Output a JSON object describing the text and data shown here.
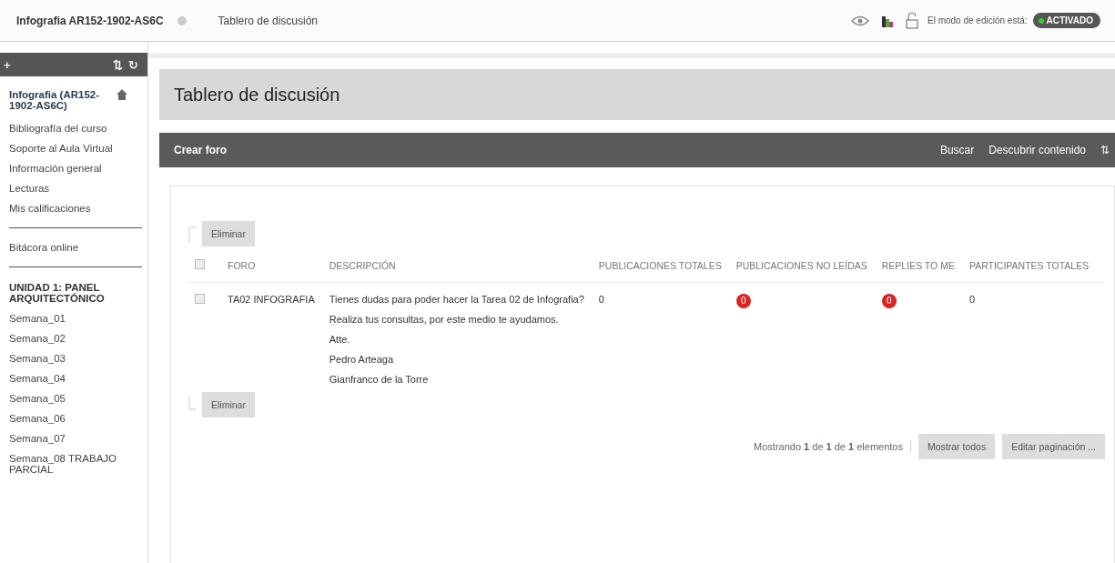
{
  "topbar": {
    "course": "Infografia AR152-1902-AS6C",
    "crumb": "Tablero de discusión",
    "edit_label": "El modo de edición está:",
    "edit_mode": {
      "label": "ACTIVADO",
      "on": true
    }
  },
  "sidebar": {
    "header": {
      "add": "+",
      "sort": "⇅",
      "refresh": "↻"
    },
    "items": [
      {
        "kind": "course",
        "label": "Infografia (AR152-1902-AS6C)"
      },
      {
        "kind": "link",
        "label": "Bibliografía del curso"
      },
      {
        "kind": "link",
        "label": "Soporte al Aula Virtual"
      },
      {
        "kind": "link",
        "label": "Información general"
      },
      {
        "kind": "link",
        "label": "Lecturas"
      },
      {
        "kind": "link",
        "label": "Mis calificaciones"
      },
      {
        "kind": "divider"
      },
      {
        "kind": "link",
        "label": "Bitácora online"
      },
      {
        "kind": "divider"
      },
      {
        "kind": "heading",
        "label": "UNIDAD 1: PANEL ARQUITECTÓNICO"
      },
      {
        "kind": "link",
        "label": "Semana_01"
      },
      {
        "kind": "link",
        "label": "Semana_02"
      },
      {
        "kind": "link",
        "label": "Semana_03"
      },
      {
        "kind": "link",
        "label": "Semana_04"
      },
      {
        "kind": "link",
        "label": "Semana_05"
      },
      {
        "kind": "link",
        "label": "Semana_06"
      },
      {
        "kind": "link",
        "label": "Semana_07"
      },
      {
        "kind": "link",
        "label": "Semana_08 TRABAJO PARCIAL"
      }
    ]
  },
  "page": {
    "title": "Tablero de discusión"
  },
  "toolbar": {
    "create": "Crear foro",
    "search": "Buscar",
    "discover": "Descubrir contenido",
    "sort": "⇅"
  },
  "delete_button": "Eliminar",
  "table": {
    "select_all": false,
    "columns": [
      "FORO",
      "DESCRIPCIÓN",
      "PUBLICACIONES TOTALES",
      "PUBLICACIONES NO LEÍDAS",
      "REPLIES TO ME",
      "PARTICIPANTES TOTALES"
    ],
    "rows": [
      {
        "checked": false,
        "forum": "TA02 INFOGRAFIA",
        "description": [
          "Tienes dudas para poder hacer la Tarea 02 de Infografia?",
          "Realiza tus consultas, por este medio te ayudamos.",
          "Atte.",
          "Pedro Arteaga",
          "Gianfranco de la Torre"
        ],
        "total": "0",
        "unread": "0",
        "replies": "0",
        "participants": "0"
      }
    ]
  },
  "delete_button_bottom": "Eliminar",
  "pagination": {
    "summary": "Mostrando **1** de **1** de **1** elementos",
    "show_all": "Mostrar todos",
    "edit": "Editar paginación ..."
  }
}
